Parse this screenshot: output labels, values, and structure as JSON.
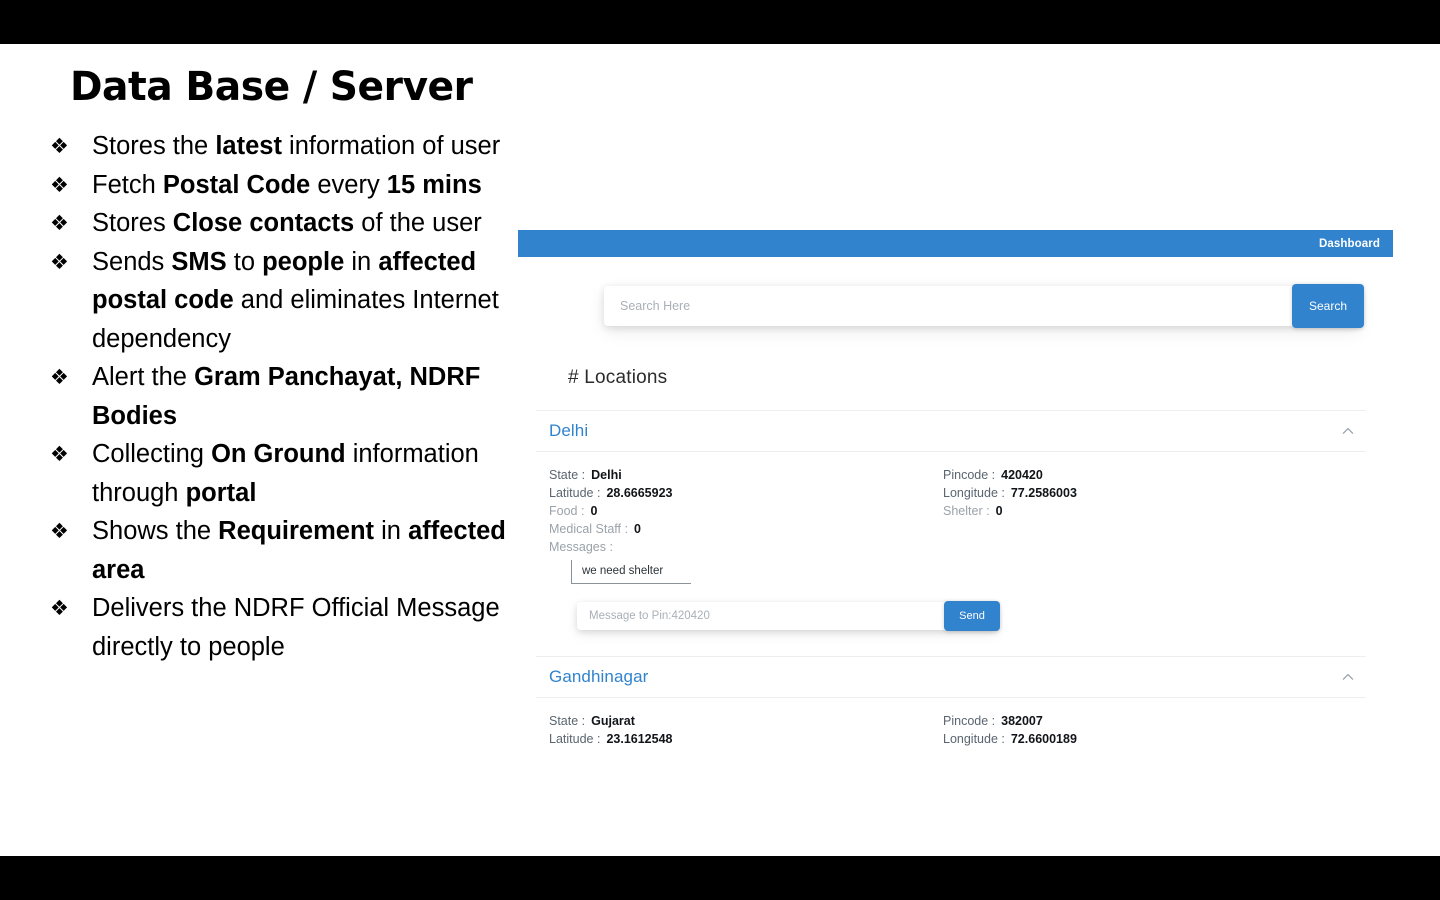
{
  "slide": {
    "title": "Data Base / Server",
    "bullet_glyph": "❖",
    "bullets": [
      [
        {
          "t": "Stores the ",
          "b": false
        },
        {
          "t": "latest",
          "b": true
        },
        {
          "t": " information of user",
          "b": false
        }
      ],
      [
        {
          "t": "Fetch ",
          "b": false
        },
        {
          "t": "Postal Code",
          "b": true
        },
        {
          "t": " every ",
          "b": false
        },
        {
          "t": "15 mins",
          "b": true
        }
      ],
      [
        {
          "t": "Stores ",
          "b": false
        },
        {
          "t": "Close contacts",
          "b": true
        },
        {
          "t": " of the user",
          "b": false
        }
      ],
      [
        {
          "t": "Sends ",
          "b": false
        },
        {
          "t": "SMS",
          "b": true
        },
        {
          "t": " to ",
          "b": false
        },
        {
          "t": "people",
          "b": true
        },
        {
          "t": " in ",
          "b": false
        },
        {
          "t": "affected postal code",
          "b": true
        },
        {
          "t": " and eliminates Internet dependency",
          "b": false
        }
      ],
      [
        {
          "t": "Alert the ",
          "b": false
        },
        {
          "t": "Gram Panchayat, NDRF Bodies",
          "b": true
        }
      ],
      [
        {
          "t": "Collecting ",
          "b": false
        },
        {
          "t": "On Ground",
          "b": true
        },
        {
          "t": " information through ",
          "b": false
        },
        {
          "t": "portal",
          "b": true
        }
      ],
      [
        {
          "t": " Shows the ",
          "b": false
        },
        {
          "t": "Requirement",
          "b": true
        },
        {
          "t": " in ",
          "b": false
        },
        {
          "t": "affected area",
          "b": true
        }
      ],
      [
        {
          "t": "Delivers the NDRF Official Message directly to people",
          "b": false
        }
      ]
    ]
  },
  "app": {
    "topbar": {
      "brand": "Dashboard",
      "background_color": "#3183ce"
    },
    "search": {
      "value": "",
      "placeholder": "Search Here",
      "button_label": "Search"
    },
    "locations_heading": "# Locations",
    "locations": [
      {
        "name": "Delhi",
        "collapse_icon": "chevron-up-icon",
        "fields": {
          "state_label": "State :",
          "state_value": "Delhi",
          "pincode_label": "Pincode :",
          "pincode_value": "420420",
          "latitude_label": "Latitude :",
          "latitude_value": "28.6665923",
          "longitude_label": "Longitude :",
          "longitude_value": "77.2586003",
          "food_label": "Food :",
          "food_value": "0",
          "shelter_label": "Shelter :",
          "shelter_value": "0",
          "medical_staff_label": "Medical Staff :",
          "medical_staff_value": "0",
          "messages_label": "Messages :"
        },
        "messages": [
          "we need shelter"
        ],
        "compose": {
          "value": "",
          "placeholder": "Message to Pin:420420",
          "button_label": "Send"
        }
      },
      {
        "name": "Gandhinagar",
        "collapse_icon": "chevron-up-icon",
        "fields": {
          "state_label": "State :",
          "state_value": "Gujarat",
          "pincode_label": "Pincode :",
          "pincode_value": "382007",
          "latitude_label": "Latitude :",
          "latitude_value": "23.1612548",
          "longitude_label": "Longitude :",
          "longitude_value": "72.6600189"
        }
      }
    ]
  },
  "colors": {
    "accent_blue": "#3183ce",
    "link_blue": "#3183ce",
    "letterbox": "#000000",
    "slide_background": "#ffffff",
    "muted_text": "#9aa2aa",
    "label_text": "#5a6570",
    "value_text": "#111418"
  }
}
